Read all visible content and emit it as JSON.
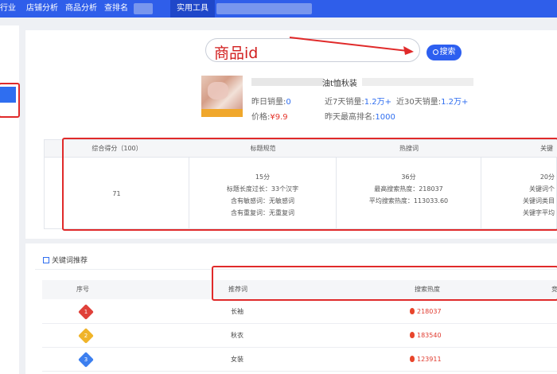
{
  "nav": {
    "items": [
      "行业",
      "店铺分析",
      "商品分析",
      "查排名",
      "实用工具"
    ]
  },
  "search": {
    "value": "商品id",
    "button": "搜索"
  },
  "product": {
    "title_fragment": "油t恤秋装",
    "thumb_tag": "",
    "yesterday_label": "昨日销量:",
    "yesterday_value": "0",
    "d7_label": "近7天销量:",
    "d7_value": "1.2万+",
    "d30_label": "近30天销量:",
    "d30_value": "1.2万+",
    "price_label": "价格:",
    "price_value": "¥9.9",
    "rank_label": "昨天最高排名:",
    "rank_value": "1000"
  },
  "score": {
    "headers": [
      "综合得分（100）",
      "标题规范",
      "热搜词",
      "关键"
    ],
    "total": "71",
    "title_col": [
      "15分",
      "标题长度过长：33个汉字",
      "含有敏感词：无敏感词",
      "含有重复词：无重复词"
    ],
    "hot_col": [
      "36分",
      "最高搜索热度：218037",
      "平均搜索热度：113033.60"
    ],
    "kw_col": [
      "20分",
      "关键词个",
      "关键词类目",
      "关键字平均"
    ]
  },
  "keywords": {
    "section_title": "关键词推荐",
    "headers": [
      "序号",
      "推荐词",
      "搜索热度",
      "竞"
    ],
    "rows": [
      {
        "rank": "1",
        "word": "长袖",
        "heat": "218037"
      },
      {
        "rank": "2",
        "word": "秋衣",
        "heat": "183540"
      },
      {
        "rank": "3",
        "word": "女装",
        "heat": "123911"
      }
    ]
  }
}
